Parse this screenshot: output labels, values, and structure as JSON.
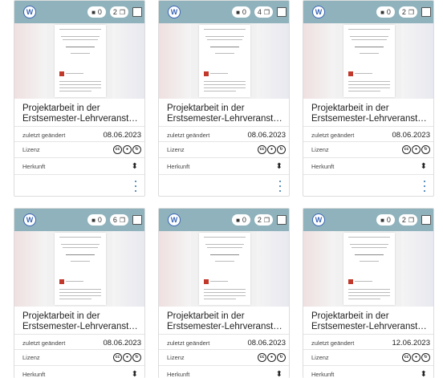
{
  "labels": {
    "modified": "zuletzt geändert",
    "license": "Lizenz",
    "origin": "Herkunft"
  },
  "cards": [
    {
      "title_line1": "Projektarbeit in der",
      "title_line2": "Erstsemester-Lehrveranstaltun...",
      "comments": "0",
      "copies": "2",
      "date": "08.06.2023"
    },
    {
      "title_line1": "Projektarbeit in der",
      "title_line2": "Erstsemester-Lehrveranstaltun...",
      "comments": "0",
      "copies": "4",
      "date": "08.06.2023"
    },
    {
      "title_line1": "Projektarbeit in der",
      "title_line2": "Erstsemester-Lehrveranstaltun...",
      "comments": "0",
      "copies": "2",
      "date": "08.06.2023"
    },
    {
      "title_line1": "Projektarbeit in der",
      "title_line2": "Erstsemester-Lehrveranstaltun...",
      "comments": "0",
      "copies": "6",
      "date": "08.06.2023"
    },
    {
      "title_line1": "Projektarbeit in der",
      "title_line2": "Erstsemester-Lehrveranstaltun...",
      "comments": "0",
      "copies": "2",
      "date": "08.06.2023"
    },
    {
      "title_line1": "Projektarbeit in der",
      "title_line2": "Erstsemester-Lehrveranstaltun...",
      "comments": "0",
      "copies": "2",
      "date": "12.06.2023"
    }
  ],
  "icons": {
    "file_type": "word-document-icon",
    "comments": "comment-icon",
    "copies": "copy-icon",
    "license": "creative-commons-icon",
    "origin": "person-icon",
    "menu": "more-vertical-icon"
  },
  "colors": {
    "header_bar": "#8fb2bc",
    "word_blue": "#3b66b6",
    "menu_blue": "#2a6fa8"
  }
}
